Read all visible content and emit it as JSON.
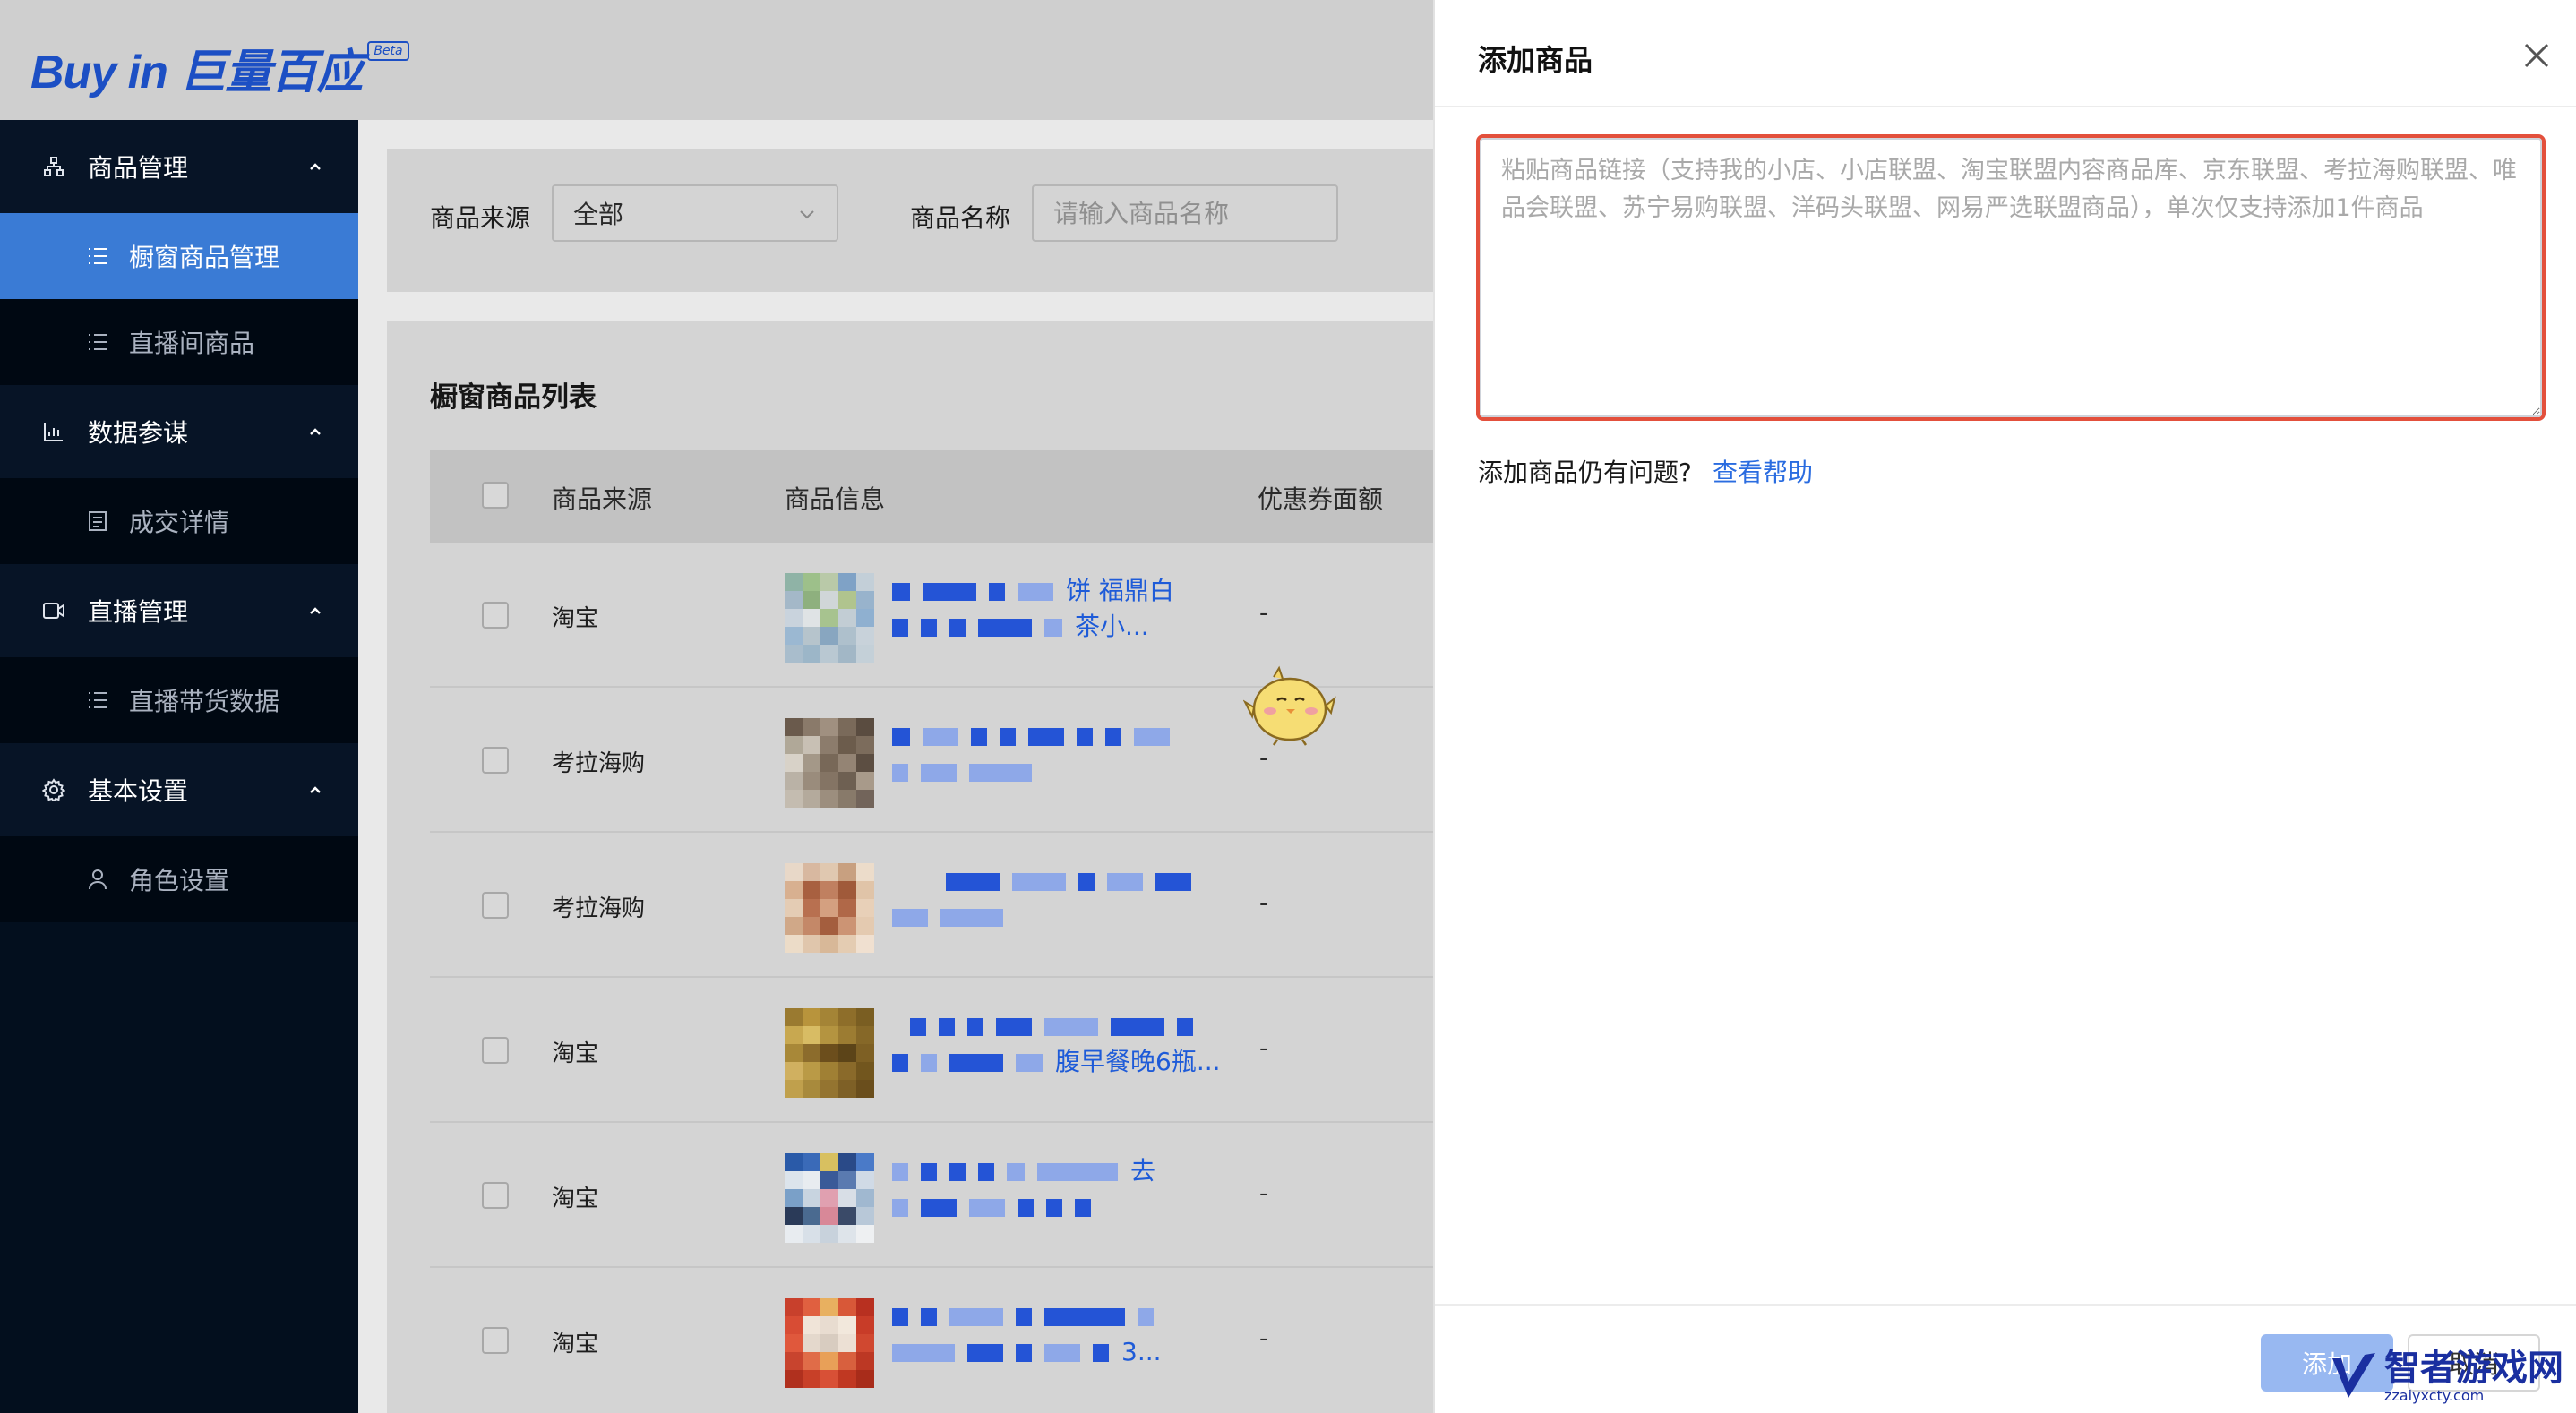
{
  "brand": {
    "logo_text": "Buy in 巨量百应",
    "badge": "Beta"
  },
  "sidebar": {
    "groups": [
      {
        "label": "商品管理",
        "icon": "org-icon",
        "items": [
          {
            "label": "橱窗商品管理",
            "active": true
          },
          {
            "label": "直播间商品",
            "active": false
          }
        ]
      },
      {
        "label": "数据参谋",
        "icon": "bar-chart-icon",
        "items": [
          {
            "label": "成交详情",
            "active": false
          }
        ]
      },
      {
        "label": "直播管理",
        "icon": "video-icon",
        "items": [
          {
            "label": "直播带货数据",
            "active": false
          }
        ]
      },
      {
        "label": "基本设置",
        "icon": "gear-icon",
        "items": [
          {
            "label": "角色设置",
            "active": false
          }
        ]
      }
    ]
  },
  "filters": {
    "source_label": "商品来源",
    "source_value": "全部",
    "name_label": "商品名称",
    "name_placeholder": "请输入商品名称"
  },
  "list": {
    "title": "橱窗商品列表",
    "columns": [
      "商品来源",
      "商品信息",
      "优惠券面额"
    ],
    "rows": [
      {
        "source": "淘宝",
        "line1_tail": "饼 福鼎白",
        "line2_tail": "茶小...",
        "coupon": "-"
      },
      {
        "source": "考拉海购",
        "line1_tail": "",
        "line2_tail": "",
        "coupon": "-"
      },
      {
        "source": "考拉海购",
        "line1_tail": "",
        "line2_tail": "",
        "coupon": "-"
      },
      {
        "source": "淘宝",
        "line1_tail": "",
        "line2_tail": "腹早餐晚6瓶...",
        "coupon": "-"
      },
      {
        "source": "淘宝",
        "line1_tail": "去",
        "line2_tail": "",
        "coupon": "-"
      },
      {
        "source": "淘宝",
        "line1_tail": "",
        "line2_tail": "3...",
        "coupon": "-"
      }
    ]
  },
  "drawer": {
    "title": "添加商品",
    "textarea_placeholder": "粘贴商品链接（支持我的小店、小店联盟、淘宝联盟内容商品库、京东联盟、考拉海购联盟、唯品会联盟、苏宁易购联盟、洋码头联盟、网易严选联盟商品），单次仅支持添加1件商品",
    "help_question": "添加商品仍有问题?",
    "help_link": "查看帮助",
    "add_button": "添加",
    "cancel_button": "取消"
  },
  "watermark": {
    "title": "智者游戏网",
    "url": "zzaiyxcty.com"
  },
  "colors": {
    "accent": "#3a7bd5",
    "link": "#2a6ce0",
    "highlight_border": "#e3503c",
    "sidebar_bg": "#030f1e"
  }
}
